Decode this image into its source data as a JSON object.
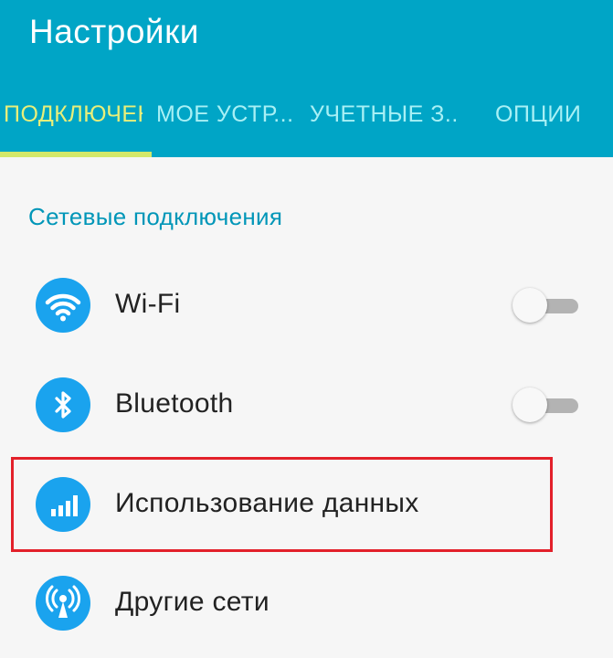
{
  "app": {
    "title": "Настройки"
  },
  "tabs": [
    {
      "label": "ПОДКЛЮЧЕНИЯ",
      "active": true
    },
    {
      "label": "МОЕ УСТР...",
      "active": false
    },
    {
      "label": "УЧЕТНЫЕ З...",
      "active": false
    },
    {
      "label": "ОПЦИИ",
      "active": false
    }
  ],
  "section": {
    "header": "Сетевые подключения"
  },
  "items": [
    {
      "label": "Wi-Fi",
      "icon": "wifi-icon",
      "toggle": "off"
    },
    {
      "label": "Bluetooth",
      "icon": "bluetooth-icon",
      "toggle": "off"
    },
    {
      "label": "Использование данных",
      "icon": "data-usage-icon",
      "highlighted": true
    },
    {
      "label": "Другие сети",
      "icon": "antenna-icon"
    }
  ],
  "colors": {
    "appbar": "#00a5c6",
    "active_tab": "#e8ef7a",
    "inactive_tab": "#a8f0f5",
    "section_header": "#0096b8",
    "icon_circle": "#1aa3ee",
    "highlight": "#e3202a",
    "background": "#f6f6f6"
  }
}
